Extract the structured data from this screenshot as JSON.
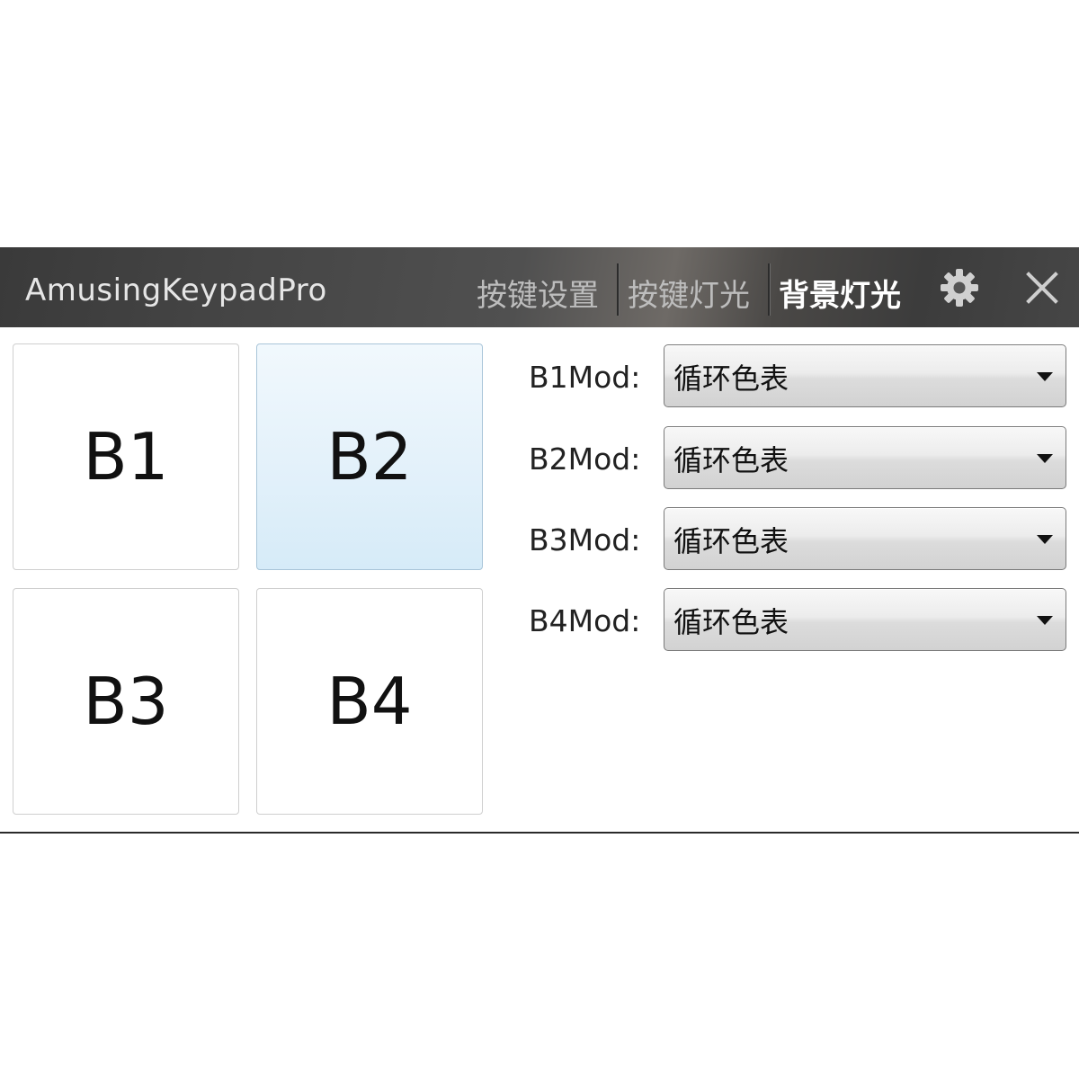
{
  "app": {
    "title": "AmusingKeypadPro"
  },
  "nav": {
    "tabs": [
      {
        "label": "按键设置",
        "active": false
      },
      {
        "label": "按键灯光",
        "active": false
      },
      {
        "label": "背景灯光",
        "active": true
      }
    ],
    "settings_icon": "gear-icon",
    "close_icon": "close-icon"
  },
  "keys": [
    {
      "label": "B1",
      "selected": false
    },
    {
      "label": "B2",
      "selected": true
    },
    {
      "label": "B3",
      "selected": false
    },
    {
      "label": "B4",
      "selected": false
    }
  ],
  "mods": [
    {
      "label": "B1Mod:",
      "value": "循环色表"
    },
    {
      "label": "B2Mod:",
      "value": "循环色表"
    },
    {
      "label": "B3Mod:",
      "value": "循环色表"
    },
    {
      "label": "B4Mod:",
      "value": "循环色表"
    }
  ],
  "colors": {
    "titlebar": "#444444",
    "selected_key": "#e3f1fa",
    "active_tab": "#ffffff",
    "inactive_tab": "#bdbdbd"
  }
}
